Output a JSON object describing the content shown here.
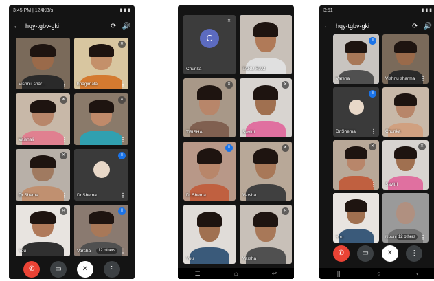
{
  "phone1": {
    "status_time": "3:45 PM | 124KB/s",
    "status_right": "▮ ▮ ▮",
    "meeting_code": "hqy-tgbv-gki",
    "tiles": [
      {
        "name": "Vishnu shar...",
        "mic": "🎙"
      },
      {
        "name": "bhagimala",
        "mic": "🎙"
      },
      {
        "name": "Vaishali",
        "mic": "🎙"
      },
      {
        "name": "",
        "mic": "🎙"
      },
      {
        "name": "Dr.Shema",
        "mic": "🎙"
      },
      {
        "name": "Dr.Shema",
        "mic": "⋮"
      },
      {
        "name": "You",
        "mic": "🎙"
      },
      {
        "name": "Varsha",
        "mic": "⋮"
      }
    ],
    "others": "12 others"
  },
  "phone2": {
    "tiles": [
      {
        "name": "Chunka",
        "mic": "🎙",
        "avatar": "C"
      },
      {
        "name": "TARU RAM",
        "mic": ""
      },
      {
        "name": "TRISHA",
        "mic": "🎙"
      },
      {
        "name": "Savitri",
        "mic": "🎙"
      },
      {
        "name": "Dr.Shema",
        "mic": "⋮"
      },
      {
        "name": "Varsha",
        "mic": "🎙"
      },
      {
        "name": "You",
        "mic": ""
      },
      {
        "name": "Varsha",
        "mic": "🎙"
      }
    ]
  },
  "phone3": {
    "status_time": "3:51",
    "meeting_code": "hqy-tgbv-gki",
    "tiles": [
      {
        "name": "Varsha",
        "mic": "⋮"
      },
      {
        "name": "Vishnu sharma",
        "mic": ""
      },
      {
        "name": "Dr.Shema",
        "mic": "⋮"
      },
      {
        "name": "Chunka",
        "mic": ""
      },
      {
        "name": "",
        "mic": "🎙"
      },
      {
        "name": "Savitri",
        "mic": "🎙"
      },
      {
        "name": "You",
        "mic": ""
      },
      {
        "name": "Neetu",
        "mic": ""
      }
    ],
    "others": "12 others"
  },
  "colors": {
    "end_call": "#ea4335",
    "speaking": "#1a73e8",
    "active_border": "#8ab4f8"
  }
}
